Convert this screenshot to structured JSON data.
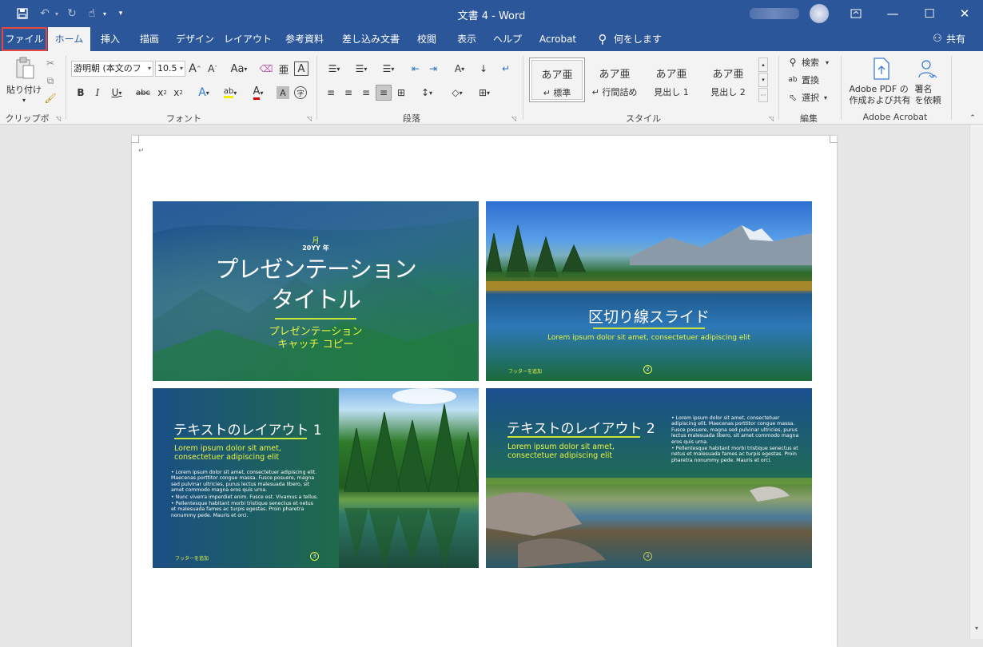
{
  "titlebar": {
    "title": "文書 4  -  Word"
  },
  "tabs": [
    "ファイル",
    "ホーム",
    "挿入",
    "描画",
    "デザイン",
    "レイアウト",
    "参考資料",
    "差し込み文書",
    "校閲",
    "表示",
    "ヘルプ",
    "Acrobat"
  ],
  "tell_me": "何をしますか",
  "share": "共有",
  "ribbon": {
    "clipboard": {
      "paste": "貼り付け",
      "label": "クリップボード"
    },
    "font": {
      "name": "游明朝 (本文のフ",
      "size": "10.5",
      "case_btn": "Aa",
      "label": "フォント"
    },
    "paragraph": {
      "label": "段落"
    },
    "styles": {
      "items": [
        {
          "sample": "あア亜",
          "name": "標準"
        },
        {
          "sample": "あア亜",
          "name": "行間詰め"
        },
        {
          "sample": "あア亜",
          "name": "見出し 1"
        },
        {
          "sample": "あア亜",
          "name": "見出し 2"
        }
      ],
      "label": "スタイル"
    },
    "editing": {
      "find": "検索",
      "replace": "置換",
      "select": "選択",
      "label": "編集"
    },
    "acrobat": {
      "create_pdf": "Adobe PDF の\n作成および共有",
      "sign": "署名\nを依頼",
      "label": "Adobe Acrobat"
    }
  },
  "slides": {
    "s1": {
      "month": "月",
      "year": "20YY 年",
      "title": "プレゼンテーション\nタイトル",
      "subtitle": "プレゼンテーション\nキャッチ コピー"
    },
    "s2": {
      "title": "区切り線スライド",
      "subtitle": "Lorem ipsum dolor sit amet, consectetuer adipiscing elit",
      "footer": "フッターを追加",
      "num": "2"
    },
    "s3": {
      "title": "テキストのレイアウト 1",
      "subtitle": "Lorem ipsum dolor sit amet,\nconsectetuer adipiscing elit",
      "bullets": [
        "Lorem ipsum dolor sit amet, consectetuer adipiscing elit. Maecenas porttitor congue massa. Fusce posuere, magna sed pulvinar ultricies, purus lectus malesuada libero, sit amet commodo magna eros quis urna.",
        "Nunc viverra imperdiet enim. Fusce est. Vivamus a tellus.",
        "Pellentesque habitant morbi tristique senectus et netus et malesuada fames ac turpis egestas. Proin pharetra nonummy pede. Mauris et orci."
      ],
      "footer": "フッターを追加",
      "num": "3"
    },
    "s4": {
      "title": "テキストのレイアウト 2",
      "subtitle": "Lorem ipsum dolor sit amet,\nconsectetuer adipiscing elit",
      "bullets": [
        "Lorem ipsum dolor sit amet, consectetuer adipiscing elit. Maecenas porttitor congue massa. Fusce posuere, magna sed pulvinar ultricies, purus lectus malesuada libero, sit amet commodo magna eros quis urna.",
        "Pellentesque habitant morbi tristique senectus et netus et malesuada fames ac turpis egestas. Proin pharetra nonummy pede. Mauris et orci."
      ],
      "footer": "フッターを追加",
      "num": "4"
    }
  },
  "colors": {
    "brand": "#2b579a",
    "accent_yellow": "#e8f542",
    "highlight_red": "#e8473d"
  }
}
